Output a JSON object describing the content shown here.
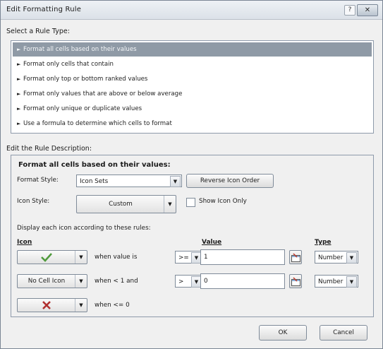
{
  "window": {
    "title": "Edit Formatting Rule",
    "help_label": "?",
    "close_label": "✕"
  },
  "select_rule_type": {
    "label": "Select a Rule Type:",
    "items": [
      "Format all cells based on their values",
      "Format only cells that contain",
      "Format only top or bottom ranked values",
      "Format only values that are above or below average",
      "Format only unique or duplicate values",
      "Use a formula to determine which cells to format"
    ],
    "selected_index": 0
  },
  "edit_rule": {
    "label": "Edit the Rule Description:",
    "heading": "Format all cells based on their values:",
    "format_style_label": "Format Style:",
    "format_style_value": "Icon Sets",
    "reverse_icon_order_label": "Reverse Icon Order",
    "icon_style_label": "Icon Style:",
    "icon_style_value": "Custom",
    "show_icon_only_label": "Show Icon Only",
    "show_icon_only_checked": false,
    "rules_caption": "Display each icon according to these rules:",
    "col_icon": "Icon",
    "col_value": "Value",
    "col_type": "Type",
    "rows": [
      {
        "icon": "check-mark-icon",
        "condition": "when value is",
        "operator": ">=",
        "value": "1",
        "type": "Number"
      },
      {
        "icon_text": "No Cell Icon",
        "condition": "when < 1 and",
        "operator": ">",
        "value": "0",
        "type": "Number"
      },
      {
        "icon": "red-x-icon",
        "condition": "when <= 0"
      }
    ]
  },
  "footer": {
    "ok_label": "OK",
    "cancel_label": "Cancel"
  },
  "colors": {
    "selected_row": "#8f9aa6",
    "check": "#4f9a3c",
    "x_mark": "#b03030"
  }
}
